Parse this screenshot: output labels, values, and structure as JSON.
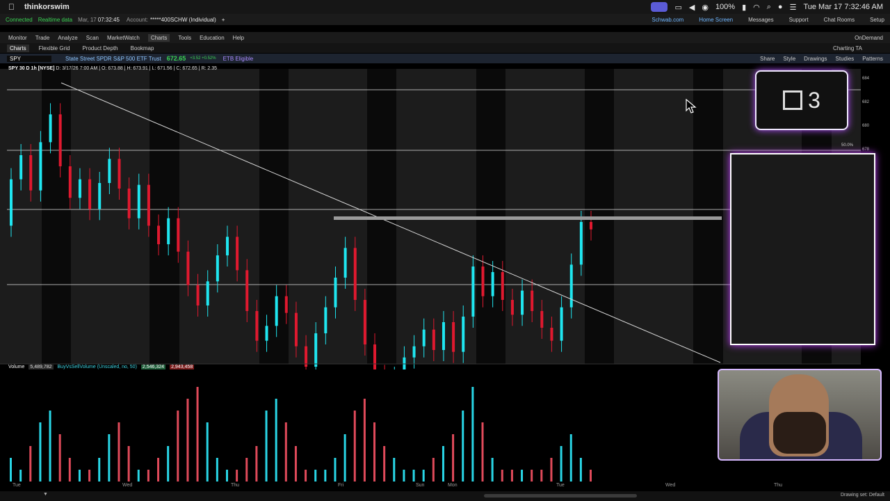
{
  "menubar": {
    "app": "thinkorswim",
    "battery": "100%",
    "datetime": "Tue Mar 17  7:32:46 AM"
  },
  "statusbar": {
    "connected": "Connected",
    "realtime": "Realtime data",
    "date": "Mar, 17",
    "time": "07:32:45",
    "account_label": "Account:",
    "account": "*****400SCHW (Individual)",
    "links": [
      "Schwab.com",
      "Home Screen",
      "Messages",
      "Support",
      "Chat Rooms",
      "Setup"
    ]
  },
  "menurow": {
    "items": [
      "Monitor",
      "Trade",
      "Analyze",
      "Scan",
      "MarketWatch",
      "Charts",
      "Tools",
      "Education",
      "Help"
    ],
    "active": "Charts",
    "right": "OnDemand"
  },
  "subtabs": {
    "items": [
      "Charts",
      "Flexible Grid",
      "Product Depth",
      "Bookmap"
    ],
    "right": "Charting TA"
  },
  "symbolrow": {
    "symbol": "SPY",
    "description": "State Street SPDR S&P 500 ETF Trust",
    "price": "672.65",
    "change": "+3.52 +0.52%",
    "etb": "ETB Eligible",
    "tools": [
      "Share",
      "Style",
      "Drawings",
      "Studies",
      "Patterns"
    ]
  },
  "chartinfo": {
    "title": "SPY 30 D 1h [NYSE]",
    "ohlc": "D: 3/17/26 7:00 AM  | O: 673.88  | H: 673.91  | L: 671.56  | C: 672.65  | R: 2.35"
  },
  "volume": {
    "label": "Volume",
    "value": "5,489,782",
    "study": "BuyVsSellVolume (Unscaled, no, 50)",
    "buy": "2,546,324",
    "sell": "2,943,458"
  },
  "yaxis": [
    "684",
    "682",
    "680",
    "678",
    "50.0%"
  ],
  "fib_label": "50.0%",
  "xaxis": [
    "Tue",
    "Wed",
    "Thu",
    "Fri",
    "Sun",
    "Mon",
    "Tue",
    "Wed",
    "Thu"
  ],
  "footer": {
    "drawing_set": "Drawing set: Default"
  },
  "counter": {
    "value": "3"
  },
  "chart_data": {
    "type": "candlestick",
    "title": "SPY 30 D 1h [NYSE]",
    "y_range": [
      670,
      685
    ],
    "candles": [
      {
        "o": 677.0,
        "c": 679.5,
        "up": true
      },
      {
        "o": 679.5,
        "c": 680.8,
        "up": true
      },
      {
        "o": 680.8,
        "c": 678.9,
        "up": false
      },
      {
        "o": 678.9,
        "c": 681.5,
        "up": true
      },
      {
        "o": 681.5,
        "c": 683.0,
        "up": true
      },
      {
        "o": 683.0,
        "c": 680.2,
        "up": false
      },
      {
        "o": 680.2,
        "c": 678.5,
        "up": false
      },
      {
        "o": 678.5,
        "c": 679.5,
        "up": true
      },
      {
        "o": 679.5,
        "c": 677.9,
        "up": false
      },
      {
        "o": 677.9,
        "c": 679.3,
        "up": true
      },
      {
        "o": 679.3,
        "c": 680.6,
        "up": true
      },
      {
        "o": 680.6,
        "c": 679.0,
        "up": false
      },
      {
        "o": 679.0,
        "c": 677.4,
        "up": false
      },
      {
        "o": 677.4,
        "c": 679.2,
        "up": true
      },
      {
        "o": 679.2,
        "c": 677.0,
        "up": false
      },
      {
        "o": 677.0,
        "c": 676.0,
        "up": false
      },
      {
        "o": 676.0,
        "c": 677.4,
        "up": true
      },
      {
        "o": 677.4,
        "c": 675.6,
        "up": false
      },
      {
        "o": 675.6,
        "c": 673.8,
        "up": false
      },
      {
        "o": 673.8,
        "c": 672.7,
        "up": false
      },
      {
        "o": 672.7,
        "c": 674.0,
        "up": true
      },
      {
        "o": 674.0,
        "c": 675.4,
        "up": true
      },
      {
        "o": 675.4,
        "c": 676.4,
        "up": true
      },
      {
        "o": 676.4,
        "c": 674.6,
        "up": false
      },
      {
        "o": 674.6,
        "c": 672.4,
        "up": false
      },
      {
        "o": 672.4,
        "c": 670.8,
        "up": false
      },
      {
        "o": 670.8,
        "c": 671.6,
        "up": true
      },
      {
        "o": 671.6,
        "c": 673.2,
        "up": true
      },
      {
        "o": 673.2,
        "c": 672.3,
        "up": false
      },
      {
        "o": 672.3,
        "c": 670.5,
        "up": false
      },
      {
        "o": 670.5,
        "c": 669.4,
        "up": false
      },
      {
        "o": 669.4,
        "c": 671.2,
        "up": true
      },
      {
        "o": 671.2,
        "c": 672.6,
        "up": true
      },
      {
        "o": 672.6,
        "c": 674.2,
        "up": true
      },
      {
        "o": 674.2,
        "c": 675.8,
        "up": true
      },
      {
        "o": 675.8,
        "c": 673.0,
        "up": false
      },
      {
        "o": 673.0,
        "c": 670.6,
        "up": false
      },
      {
        "o": 670.6,
        "c": 668.9,
        "up": false
      },
      {
        "o": 668.9,
        "c": 667.6,
        "up": false
      },
      {
        "o": 667.6,
        "c": 668.8,
        "up": true
      },
      {
        "o": 668.8,
        "c": 669.9,
        "up": true
      },
      {
        "o": 669.9,
        "c": 670.5,
        "up": true
      },
      {
        "o": 670.5,
        "c": 671.4,
        "up": true
      },
      {
        "o": 671.4,
        "c": 670.3,
        "up": false
      },
      {
        "o": 670.3,
        "c": 671.8,
        "up": true
      },
      {
        "o": 671.8,
        "c": 670.2,
        "up": false
      },
      {
        "o": 670.2,
        "c": 672.1,
        "up": true
      },
      {
        "o": 672.1,
        "c": 674.8,
        "up": true
      },
      {
        "o": 674.8,
        "c": 673.2,
        "up": false
      },
      {
        "o": 673.2,
        "c": 674.5,
        "up": true
      },
      {
        "o": 674.5,
        "c": 673.0,
        "up": false
      },
      {
        "o": 673.0,
        "c": 672.2,
        "up": false
      },
      {
        "o": 672.2,
        "c": 673.5,
        "up": true
      },
      {
        "o": 673.5,
        "c": 672.4,
        "up": false
      },
      {
        "o": 672.4,
        "c": 671.5,
        "up": false
      },
      {
        "o": 671.5,
        "c": 670.8,
        "up": false
      },
      {
        "o": 670.8,
        "c": 672.6,
        "up": true
      },
      {
        "o": 672.6,
        "c": 674.9,
        "up": true
      },
      {
        "o": 674.9,
        "c": 677.2,
        "up": true
      },
      {
        "o": 677.2,
        "c": 676.8,
        "up": false
      }
    ],
    "volume": [
      2,
      1,
      3,
      5,
      6,
      4,
      2,
      1,
      1,
      2,
      4,
      5,
      3,
      1,
      1,
      2,
      3,
      6,
      7,
      8,
      5,
      2,
      1,
      1,
      2,
      3,
      6,
      7,
      5,
      3,
      1,
      1,
      1,
      2,
      4,
      6,
      7,
      5,
      3,
      2,
      1,
      1,
      1,
      2,
      3,
      4,
      6,
      8,
      5,
      2,
      1,
      1,
      1,
      1,
      1,
      2,
      3,
      4,
      2,
      1
    ]
  }
}
